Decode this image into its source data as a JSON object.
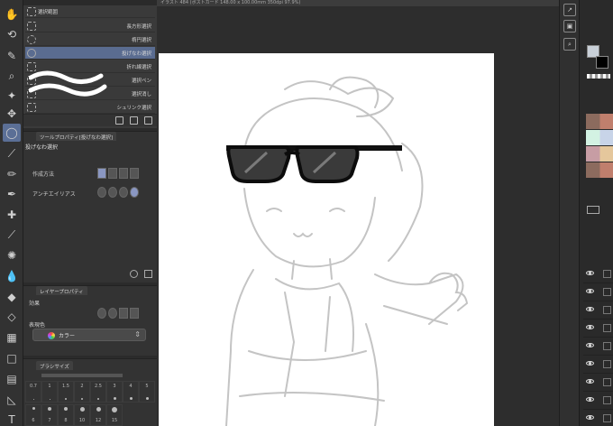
{
  "subtool": {
    "items": [
      {
        "label": "選択範囲",
        "icon": "selection-icon",
        "selected": false
      },
      {
        "label": "長方形選択",
        "icon": "rect-select-icon",
        "selected": false
      },
      {
        "label": "楕円選択",
        "icon": "ellipse-select-icon",
        "selected": false
      },
      {
        "label": "投げなわ選択",
        "icon": "lasso-icon",
        "selected": true
      },
      {
        "label": "折れ線選択",
        "icon": "polyline-select-icon",
        "selected": false
      },
      {
        "label": "選択ペン",
        "icon": "select-pen-icon",
        "selected": false
      },
      {
        "label": "選択消し",
        "icon": "select-eraser-icon",
        "selected": false
      },
      {
        "label": "シュリンク選択",
        "icon": "shrink-select-icon",
        "selected": false
      }
    ]
  },
  "tool_property": {
    "tab": "ツールプロパティ[投げなわ選択]",
    "title": "投げなわ選択",
    "mode_label": "作成方法",
    "antialias_label": "アンチエイリアス"
  },
  "layer_property": {
    "tab": "レイヤープロパティ",
    "effect_label": "効果",
    "color_label": "表現色",
    "color_value": "カラー"
  },
  "brush_size": {
    "tab": "ブラシサイズ",
    "sizes": [
      "0.7",
      "1",
      "1.5",
      "2",
      "2.5",
      "3",
      "4",
      "5",
      "6",
      "7",
      "8",
      "10",
      "12",
      "15"
    ]
  },
  "canvas": {
    "title": "イラスト 484 (ポストカード 148.00 x 100.00mm 350dpi 97.9%)"
  },
  "colors": {
    "accent": "#5a6c90",
    "panel_bg": "#333333",
    "canvas_bg": "#2d2d2d",
    "paper": "#ffffff",
    "palette": [
      "#8c6b5e",
      "#c07f6d",
      "#d3f2e3",
      "#c8d4e8",
      "#c79da4",
      "#e5c79c"
    ]
  },
  "right_buttons": [
    "navigator-icon",
    "sub-view-icon",
    "layer-search-icon"
  ]
}
